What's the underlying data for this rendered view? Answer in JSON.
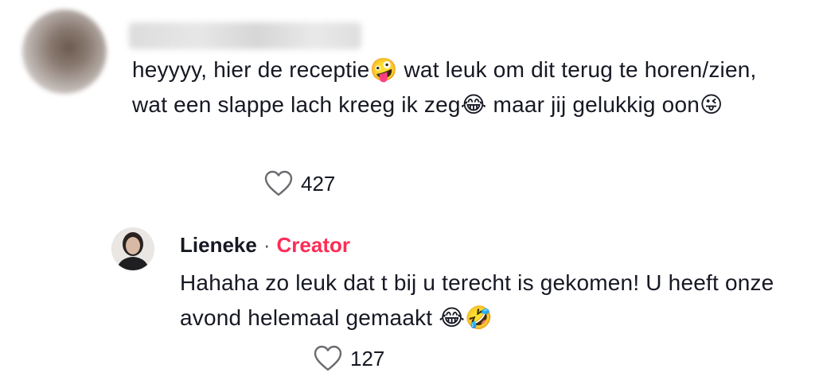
{
  "comment": {
    "text_parts": [
      "heyyyy, hier de receptie",
      "🤪",
      " wat leuk om dit terug te horen/zien, wat een slappe lach kreeg ik zeg",
      "😂",
      " maar jij gelukkig oon",
      "😜"
    ],
    "likes": "427"
  },
  "reply": {
    "author": "Lieneke",
    "separator": "·",
    "role": "Creator",
    "text_parts": [
      "Hahaha zo leuk dat t bij u terecht is gekomen! U heeft onze avond helemaal gemaakt ",
      "😂",
      "🤣"
    ],
    "likes": "127"
  },
  "icons": {
    "like": "heart-outline-icon"
  },
  "colors": {
    "creator_accent": "#fe2c55",
    "text": "#161823"
  }
}
